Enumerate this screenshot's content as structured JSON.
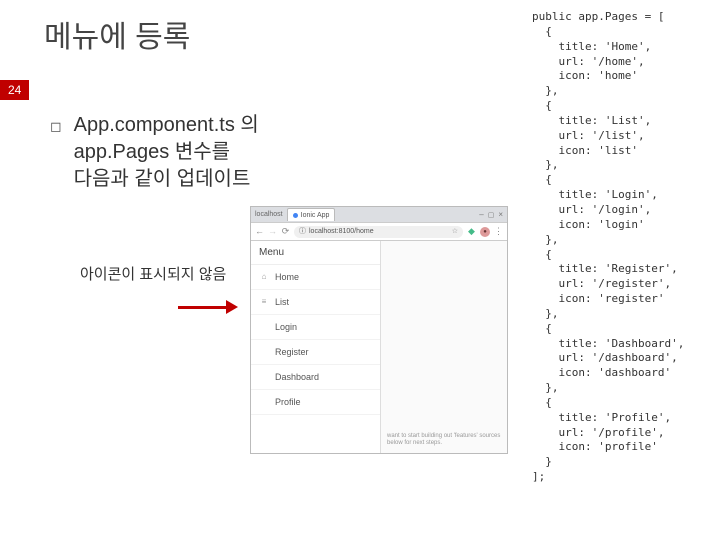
{
  "title": "메뉴에 등록",
  "page_number": "24",
  "bullet": {
    "line1": "App.component.ts 의",
    "line2": "app.Pages 변수를",
    "line3": "다음과 같이 업데이트"
  },
  "subtext": "아이콘이 표시되지 않음",
  "win_title": "localhost",
  "tab_label": "Ionic App",
  "url_text": "localhost:8100/home",
  "menu_header": "Menu",
  "menu_items": [
    "Home",
    "List",
    "Login",
    "Register",
    "Dashboard",
    "Profile"
  ],
  "content_hint": "want to start building out 'features'\nsources below for next steps.",
  "code": "public app.Pages = [\n  {\n    title: 'Home',\n    url: '/home',\n    icon: 'home'\n  },\n  {\n    title: 'List',\n    url: '/list',\n    icon: 'list'\n  },\n  {\n    title: 'Login',\n    url: '/login',\n    icon: 'login'\n  },\n  {\n    title: 'Register',\n    url: '/register',\n    icon: 'register'\n  },\n  {\n    title: 'Dashboard',\n    url: '/dashboard',\n    icon: 'dashboard'\n  },\n  {\n    title: 'Profile',\n    url: '/profile',\n    icon: 'profile'\n  }\n];"
}
